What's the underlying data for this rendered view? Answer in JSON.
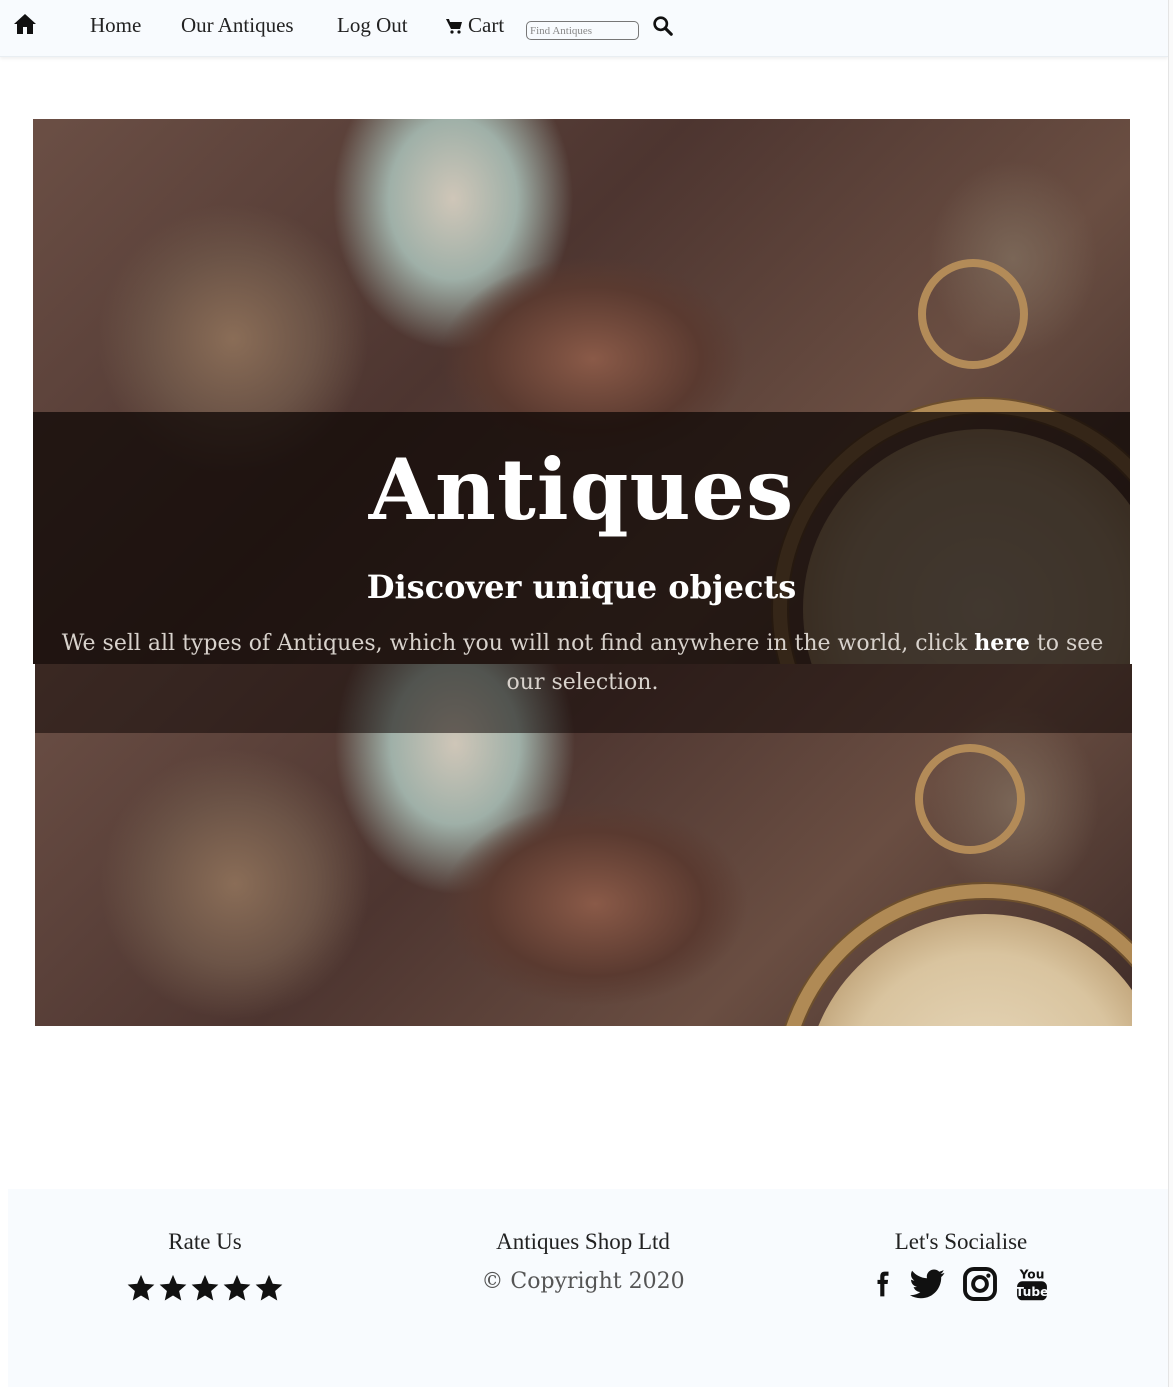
{
  "nav": {
    "home_icon": "home-icon",
    "links": [
      "Home",
      "Our Antiques",
      "Log Out"
    ],
    "cart_label": "Cart",
    "cart_icon": "cart-icon",
    "search_placeholder": "Find Antiques",
    "search_icon": "search-icon"
  },
  "hero": {
    "title": "Antiques",
    "subtitle": "Discover unique objects",
    "text_before": "We sell all types of Antiques, which you will not find anywhere in the world, click ",
    "link_label": "here",
    "text_after": " to see our selection."
  },
  "footer": {
    "rate_heading": "Rate Us",
    "stars": 5,
    "company": "Antiques Shop Ltd",
    "copyright": "© Copyright 2020",
    "social_heading": "Let's Socialise",
    "social_icons": [
      "facebook-icon",
      "twitter-icon",
      "instagram-icon",
      "youtube-icon"
    ]
  },
  "colors": {
    "navbar_bg": "#f8fbfe",
    "hero_overlay": "#120a08",
    "hero_text": "#ffffff"
  }
}
